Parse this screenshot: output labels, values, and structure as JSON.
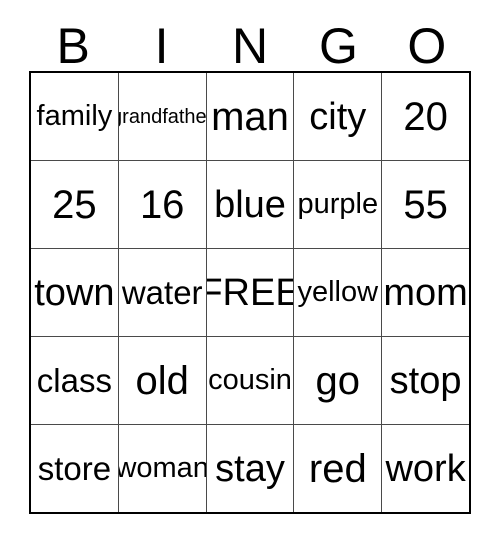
{
  "card": {
    "title": "BINGO",
    "headers": [
      "B",
      "I",
      "N",
      "G",
      "O"
    ],
    "free_space_label": "FREE",
    "grid_size": "5x5",
    "colors": {
      "background": "#ffffff",
      "text": "#000000",
      "outer_border": "#000000",
      "inner_border": "#4a4a4a"
    },
    "rows": [
      [
        {
          "text": "family",
          "size": "sm",
          "free": false
        },
        {
          "text": "grandfather",
          "size": "xs",
          "free": false
        },
        {
          "text": "man",
          "size": "xl",
          "free": false
        },
        {
          "text": "city",
          "size": "lg",
          "free": false
        },
        {
          "text": "20",
          "size": "xl",
          "free": false
        }
      ],
      [
        {
          "text": "25",
          "size": "xl",
          "free": false
        },
        {
          "text": "16",
          "size": "xl",
          "free": false
        },
        {
          "text": "blue",
          "size": "lg",
          "free": false
        },
        {
          "text": "purple",
          "size": "sm",
          "free": false
        },
        {
          "text": "55",
          "size": "xl",
          "free": false
        }
      ],
      [
        {
          "text": "town",
          "size": "lg",
          "free": false
        },
        {
          "text": "water",
          "size": "md",
          "free": false
        },
        {
          "text": "FREE",
          "size": "lg",
          "free": true
        },
        {
          "text": "yellow",
          "size": "sm",
          "free": false
        },
        {
          "text": "mom",
          "size": "lg",
          "free": false
        }
      ],
      [
        {
          "text": "class",
          "size": "md",
          "free": false
        },
        {
          "text": "old",
          "size": "xl",
          "free": false
        },
        {
          "text": "cousin",
          "size": "sm",
          "free": false
        },
        {
          "text": "go",
          "size": "xl",
          "free": false
        },
        {
          "text": "stop",
          "size": "lg",
          "free": false
        }
      ],
      [
        {
          "text": "store",
          "size": "md",
          "free": false
        },
        {
          "text": "woman",
          "size": "sm",
          "free": false
        },
        {
          "text": "stay",
          "size": "lg",
          "free": false
        },
        {
          "text": "red",
          "size": "xl",
          "free": false
        },
        {
          "text": "work",
          "size": "lg",
          "free": false
        }
      ]
    ]
  }
}
